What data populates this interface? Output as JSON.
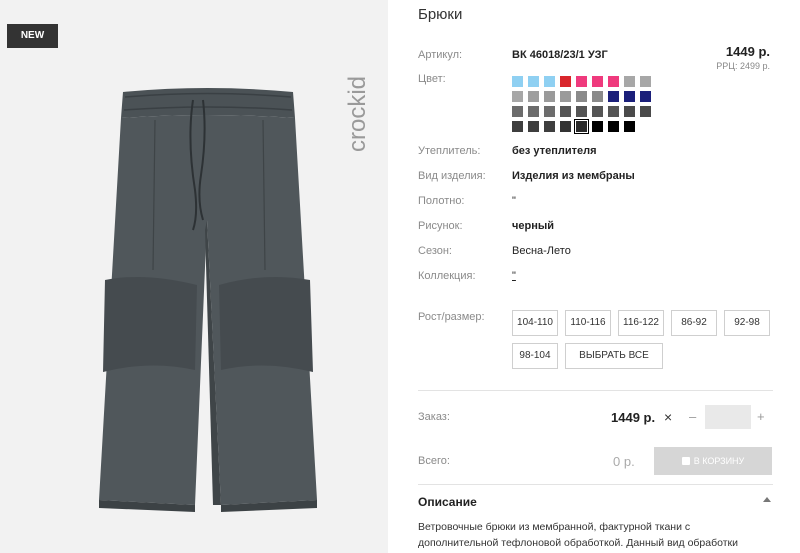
{
  "badge": "NEW",
  "brand": "crockid",
  "product": {
    "title": "Брюки",
    "article_label": "Артикул:",
    "article": "ВК 46018/23/1 УЗГ",
    "price": "1449 р.",
    "rrc": "РРЦ: 2499 р.",
    "color_label": "Цвет:"
  },
  "swatch_colors": [
    [
      "#8fd0f2",
      "#8fd0f2",
      "#8fd0f2",
      "#d9262c",
      "#ef3a7d",
      "#ef3a7d",
      "#ef3a7d",
      "#a7a7a7",
      "#a7a7a7"
    ],
    [
      "#a7a7a7",
      "#9e9e9e",
      "#9a9a9a",
      "#9a9a9a",
      "#8a8a8a",
      "#8a8a8a",
      "#1b1f7a",
      "#1b1f7a",
      "#1b1f7a"
    ],
    [
      "#6c6c6c",
      "#6c6c6c",
      "#6c6c6c",
      "#555555",
      "#555555",
      "#555555",
      "#555555",
      "#4a4a4a",
      "#4a4a4a"
    ],
    [
      "#3e3e3e",
      "#3e3e3e",
      "#3e3e3e",
      "#333333",
      "#2a2a2a",
      "#000000",
      "#000000",
      "#000000"
    ]
  ],
  "selected_swatch": "3-4",
  "attributes": [
    {
      "label": "Утеплитель:",
      "value": "без утеплителя",
      "bold": true
    },
    {
      "label": "Вид изделия:",
      "value": "Изделия из мембраны",
      "bold": true
    },
    {
      "label": "Полотно:",
      "value": "\"",
      "bold": false
    },
    {
      "label": "Рисунок:",
      "value": "черный",
      "bold": true
    },
    {
      "label": "Сезон:",
      "value": "Весна-Лето",
      "bold": false
    },
    {
      "label": "Коллекция:",
      "value": "\"",
      "bold": false
    }
  ],
  "sizes_label": "Рост/размер:",
  "sizes": [
    "104-110",
    "110-116",
    "116-122",
    "86-92",
    "92-98",
    "98-104"
  ],
  "select_all": "ВЫБРАТЬ ВСЕ",
  "order": {
    "label": "Заказ:",
    "price": "1449 р.",
    "times": "×",
    "minus": "–",
    "plus": "+",
    "qty": ""
  },
  "total": {
    "label": "Всего:",
    "value": "0 р.",
    "cart_button": "В КОРЗИНУ"
  },
  "description": {
    "title": "Описание",
    "text": "Ветровочные брюки из мембранной, фактурной ткани с дополнительной тефлоновой обработкой. Данный вид обработки"
  }
}
